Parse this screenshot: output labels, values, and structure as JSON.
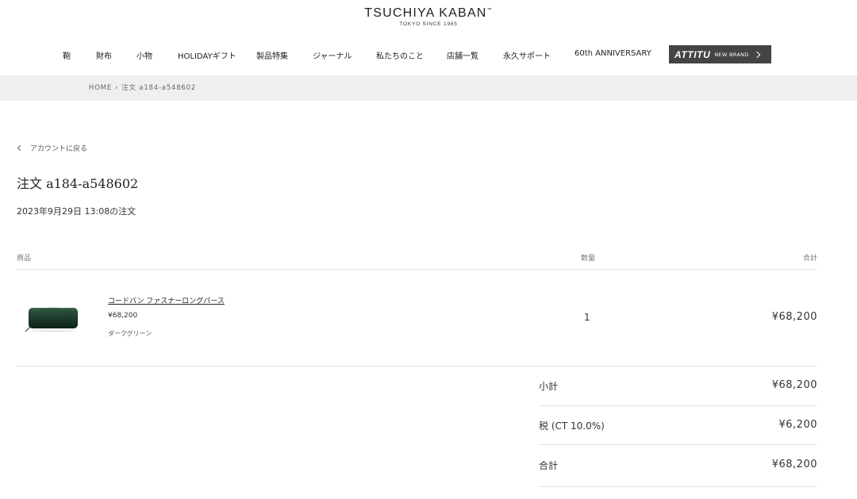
{
  "header": {
    "logo_main": "TSUCHIYA KABAN",
    "logo_tm": "™",
    "logo_sub": "TOKYO  SINCE 1965",
    "nav": [
      "鞄",
      "財布",
      "小物",
      "HOLIDAYギフト",
      "製品特集",
      "ジャーナル",
      "私たちのこと",
      "店舗一覧",
      "永久サポート",
      "60th ANNIVERSARY"
    ],
    "brand_button": {
      "name": "ATTITU",
      "sub": "NEW BRAND"
    }
  },
  "breadcrumb": {
    "home": "HOME",
    "separator": "›",
    "current": "注文 a184-a548602"
  },
  "back_link": "アカウントに戻る",
  "order": {
    "title": "注文 a184-a548602",
    "date": "2023年9月29日 13:08の注文"
  },
  "table": {
    "headers": {
      "product": "商品",
      "quantity": "数量",
      "total": "合計"
    },
    "items": [
      {
        "name": "コードバン ファスナーロングパース",
        "price": "¥68,200",
        "variant": "ダークグリーン",
        "quantity": "1",
        "total": "¥68,200",
        "thumb_color": "#1d3a2a"
      }
    ]
  },
  "summary": {
    "subtotal_label": "小計",
    "subtotal": "¥68,200",
    "tax_label": "税 (CT 10.0%)",
    "tax": "¥6,200",
    "total_label": "合計",
    "total": "¥68,200"
  }
}
